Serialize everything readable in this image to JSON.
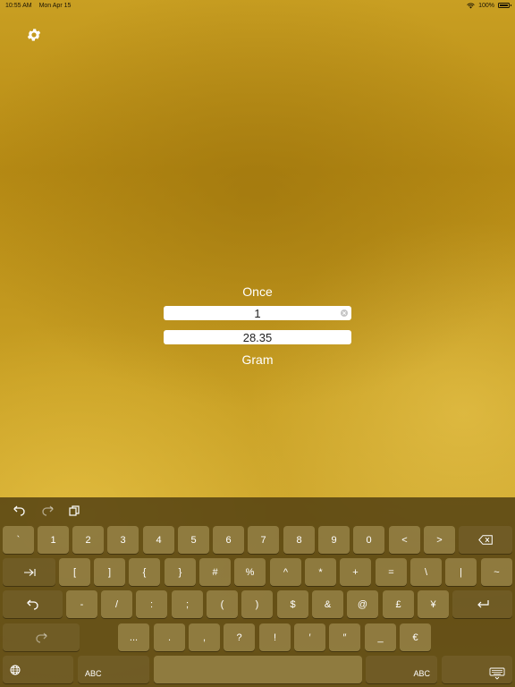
{
  "status_bar": {
    "time": "10:55 AM",
    "date": "Mon Apr 15",
    "battery": "100%"
  },
  "converter": {
    "from_unit": "Once",
    "from_value": "1",
    "to_value": "28.35",
    "to_unit": "Gram"
  },
  "colors": {
    "label": "#ffffff",
    "field_bg": "#ffffff"
  },
  "keyboard": {
    "row1": [
      "`",
      "1",
      "2",
      "3",
      "4",
      "5",
      "6",
      "7",
      "8",
      "9",
      "0",
      "<",
      ">"
    ],
    "row2": [
      "[",
      "]",
      "{",
      "}",
      "#",
      "%",
      "^",
      "*",
      "+",
      "=",
      "\\",
      "|",
      "~"
    ],
    "row3": [
      "-",
      "/",
      ":",
      ";",
      "(",
      ")",
      "$",
      "&",
      "@",
      "£",
      "¥"
    ],
    "row4": [
      "...",
      ".",
      ",",
      "?",
      "!",
      "′",
      "″",
      "_",
      "€"
    ],
    "abc_left": "ABC",
    "abc_right": "ABC"
  },
  "icons": {
    "settings": "gear-icon",
    "undo": "undo-icon",
    "redo": "redo-icon",
    "paste": "paste-icon",
    "delete": "backspace-icon",
    "tab": "tab-icon",
    "undo_key": "undo-key-icon",
    "return": "return-icon",
    "redo_key": "redo-key-icon",
    "globe": "globe-icon",
    "dismiss": "keyboard-dismiss-icon"
  }
}
